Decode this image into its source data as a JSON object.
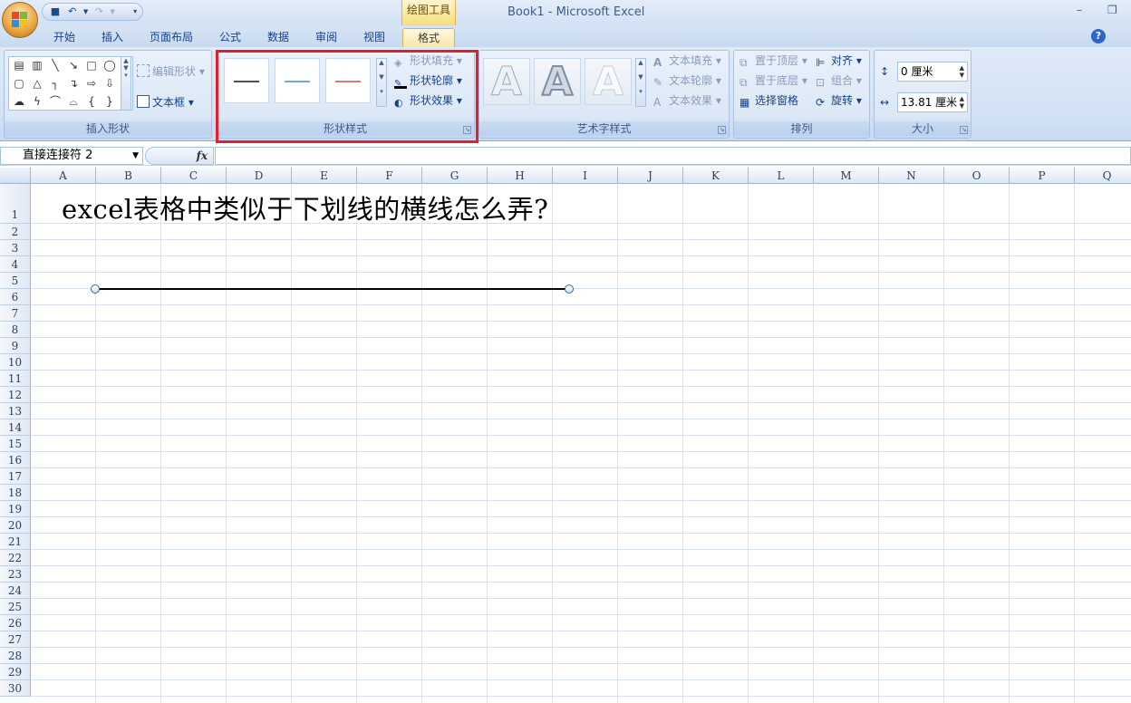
{
  "window": {
    "title": "Book1 - Microsoft Excel",
    "contextual_tab_group": "绘图工具",
    "minimize": "–",
    "restore": "❐"
  },
  "tabs": [
    {
      "label": "开始"
    },
    {
      "label": "插入"
    },
    {
      "label": "页面布局"
    },
    {
      "label": "公式"
    },
    {
      "label": "数据"
    },
    {
      "label": "审阅"
    },
    {
      "label": "视图"
    },
    {
      "label": "格式",
      "active": true
    }
  ],
  "ribbon": {
    "insert_shapes": {
      "label": "插入形状",
      "edit_shape": "编辑形状",
      "text_box": "文本框"
    },
    "shape_styles": {
      "label": "形状样式",
      "fill": "形状填充",
      "outline": "形状轮廓",
      "effects": "形状效果",
      "colors": [
        "#505050",
        "#7ba6d9",
        "#e0777a"
      ]
    },
    "wordart_styles": {
      "label": "艺术字样式",
      "text_fill": "文本填充",
      "text_outline": "文本轮廓",
      "text_effects": "文本效果",
      "sample": "A"
    },
    "arrange": {
      "label": "排列",
      "bring_front": "置于顶层",
      "send_back": "置于底层",
      "selection_pane": "选择窗格",
      "align": "对齐",
      "group": "组合",
      "rotate": "旋转"
    },
    "size": {
      "label": "大小",
      "height": "0 厘米",
      "width": "13.81 厘米"
    }
  },
  "formula_bar": {
    "name_box": "直接连接符 2",
    "fx": "fx",
    "formula": ""
  },
  "sheet": {
    "columns": [
      "A",
      "B",
      "C",
      "D",
      "E",
      "F",
      "G",
      "H",
      "I",
      "J",
      "K",
      "L",
      "M",
      "N",
      "O",
      "P",
      "Q"
    ],
    "rows": [
      "1",
      "2",
      "3",
      "4",
      "5",
      "6",
      "7",
      "8",
      "9",
      "10",
      "11",
      "12",
      "13",
      "14",
      "15",
      "16",
      "17",
      "18",
      "19",
      "20",
      "21",
      "22",
      "23",
      "24",
      "25",
      "26",
      "27",
      "28",
      "29",
      "30"
    ],
    "a1_text": "excel表格中类似于下划线的横线怎么弄?"
  }
}
